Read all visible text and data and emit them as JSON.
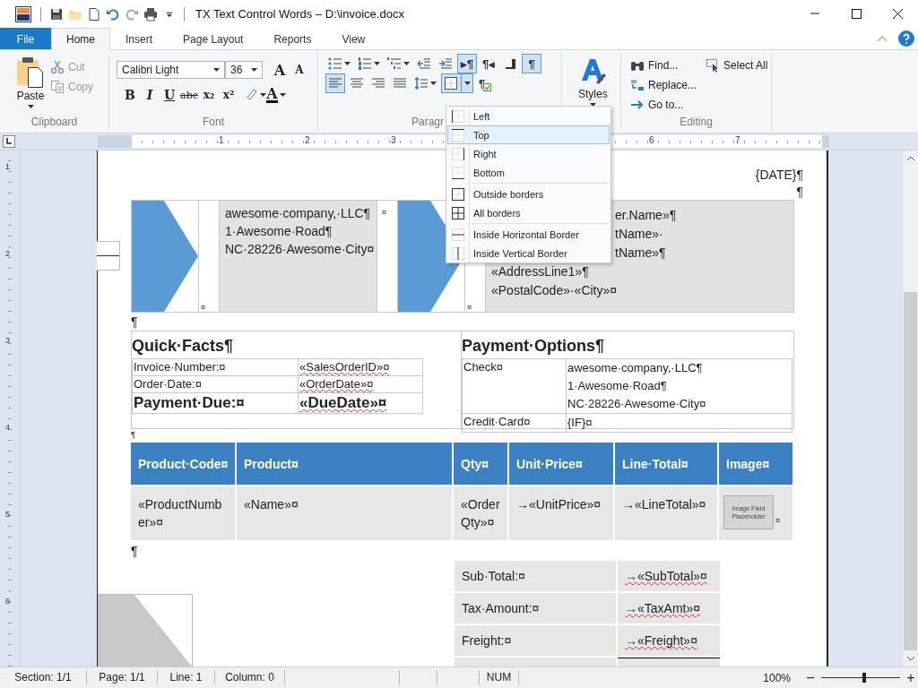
{
  "window": {
    "title": "TX Text Control Words – D:\\invoice.docx"
  },
  "quick_access": [
    {
      "kind": "save"
    },
    {
      "kind": "open"
    },
    {
      "kind": "new"
    },
    {
      "kind": "undo"
    },
    {
      "kind": "redo"
    },
    {
      "kind": "print"
    },
    {
      "kind": "customize"
    }
  ],
  "ribbon_tabs": [
    {
      "label": "File",
      "kind": "backstage",
      "selected": false
    },
    {
      "label": "Home",
      "kind": "tab",
      "selected": true
    },
    {
      "label": "Insert",
      "kind": "tab",
      "selected": false
    },
    {
      "label": "Page Layout",
      "kind": "tab",
      "selected": false
    },
    {
      "label": "Reports",
      "kind": "tab",
      "selected": false
    },
    {
      "label": "View",
      "kind": "tab",
      "selected": false
    }
  ],
  "clipboard": {
    "label": "Clipboard",
    "paste": "Paste",
    "small_buttons": [
      {
        "label": "Cut",
        "kind": "cut",
        "disabled": true
      },
      {
        "label": "Copy",
        "kind": "copy",
        "disabled": true
      }
    ]
  },
  "font": {
    "label": "Font",
    "font_name": "Calibri Light",
    "font_size": "36",
    "size_buttons": [
      {
        "glyph": "A",
        "kind": "grow"
      },
      {
        "glyph": "A",
        "kind": "shrink"
      }
    ],
    "format_buttons": [
      {
        "glyph": "B",
        "kind": "bold",
        "dropdown": false
      },
      {
        "glyph": "I",
        "kind": "italic",
        "dropdown": false
      },
      {
        "glyph": "U",
        "kind": "underline",
        "dropdown": false
      },
      {
        "glyph": "abc",
        "kind": "strike",
        "dropdown": false
      },
      {
        "glyph": "x₂",
        "kind": "sub",
        "dropdown": false
      },
      {
        "glyph": "x²",
        "kind": "sup",
        "dropdown": false
      },
      {
        "kind": "highlight",
        "dropdown": true
      },
      {
        "glyph": "A",
        "kind": "font_color",
        "dropdown": true
      }
    ]
  },
  "paragraph": {
    "label": "Paragr",
    "row1": [
      {
        "kind": "bullets",
        "dropdown": true,
        "pressed": false
      },
      {
        "kind": "numbering",
        "dropdown": true,
        "pressed": false
      },
      {
        "kind": "multilevel",
        "dropdown": true,
        "pressed": false
      },
      {
        "kind": "outdent",
        "dropdown": false,
        "pressed": false
      },
      {
        "kind": "indent",
        "dropdown": false,
        "pressed": false
      },
      {
        "kind": "ltr",
        "glyph": "▸¶",
        "dropdown": false,
        "pressed": true
      },
      {
        "kind": "rtl",
        "glyph": "¶◂",
        "dropdown": false,
        "pressed": false
      },
      {
        "kind": "tab_stop",
        "dropdown": false,
        "pressed": false
      },
      {
        "kind": "marks",
        "glyph": "¶",
        "dropdown": false,
        "pressed": true
      }
    ],
    "row2": [
      {
        "kind": "align_left",
        "dropdown": false,
        "pressed": true
      },
      {
        "kind": "align_center",
        "dropdown": false,
        "pressed": false
      },
      {
        "kind": "align_right",
        "dropdown": false,
        "pressed": false
      },
      {
        "kind": "justify",
        "dropdown": false,
        "pressed": false
      },
      {
        "kind": "line_spacing",
        "dropdown": true,
        "pressed": false
      },
      {
        "kind": "borders",
        "dropdown": true,
        "pressed": true
      },
      {
        "kind": "para_format",
        "glyph": "¶",
        "dropdown": false,
        "pressed": false
      }
    ]
  },
  "styles": {
    "label": "Styles"
  },
  "editing": {
    "label": "Editing",
    "buttons": [
      {
        "label": "Find...",
        "kind": "find"
      },
      {
        "label": "Replace...",
        "kind": "replace"
      },
      {
        "label": "Go to...",
        "kind": "goto"
      },
      {
        "label": "Select All",
        "kind": "select_all"
      }
    ]
  },
  "border_menu": {
    "groups": [
      {
        "items": [
          {
            "label": "Left",
            "kind": "left",
            "selected": false
          },
          {
            "label": "Top",
            "kind": "top",
            "selected": true
          },
          {
            "label": "Right",
            "kind": "right",
            "selected": false
          },
          {
            "label": "Bottom",
            "kind": "bottom",
            "selected": false
          }
        ]
      },
      {
        "items": [
          {
            "label": "Outside borders",
            "kind": "outside",
            "selected": false
          },
          {
            "label": "All borders",
            "kind": "all",
            "selected": false
          }
        ]
      },
      {
        "items": [
          {
            "label": "Inside Horizontal Border",
            "kind": "inside_h",
            "selected": false
          },
          {
            "label": "Inside Vertical Border",
            "kind": "inside_v",
            "selected": false
          }
        ]
      }
    ]
  },
  "horizontal_ruler": {
    "numbers": [
      "1",
      "2",
      "3",
      "6",
      "7"
    ]
  },
  "vertical_ruler": {
    "numbers": [
      "1",
      "2",
      "3",
      "4",
      "5",
      "6"
    ]
  },
  "document": {
    "date": "{DATE}¶",
    "mark_after_date": "¶",
    "header": {
      "company_lines": [
        "awesome·company,·LLC¶",
        "1·Awesome·Road¶",
        "NC·28226·Awesome·City¤"
      ],
      "cell_marks": [
        "¤",
        "¤",
        "¤"
      ],
      "customer_lines": [
        {
          "text": "er.Name»¶",
          "covered": true
        },
        {
          "text": "tName»·",
          "covered": true
        },
        {
          "text": "tName»¶",
          "covered": true
        },
        {
          "text": "«AddressLine1»¶"
        },
        {
          "text": "«PostalCode»·«City»¤"
        }
      ]
    },
    "mark_after_header": "¶",
    "quick_facts": {
      "title": "Quick·Facts¶",
      "rows": [
        {
          "label": "Invoice·Number:¤",
          "value": "«SalesOrderID»¤",
          "emphasis": false
        },
        {
          "label": "Order·Date:¤",
          "value": "«OrderDate»¤",
          "emphasis": false
        },
        {
          "label": "Payment·Due:¤",
          "value": "«DueDate»¤",
          "emphasis": true
        }
      ]
    },
    "payment_options": {
      "title": "Payment·Options¶",
      "rows": [
        {
          "label": "Check¤",
          "lines": [
            "awesome·company,·LLC¶",
            "1·Awesome·Road¶",
            "NC·28226·Awesome·City¤"
          ]
        },
        {
          "label": "Credit·Card¤",
          "lines": [
            "{IF}¤"
          ]
        }
      ]
    },
    "mark_after_facts": "¶",
    "products": {
      "columns": [
        "Product·Code¤",
        "Product¤",
        "Qty¤",
        "Unit·Price¤",
        "Line·Total¤",
        "Image¤"
      ],
      "row": [
        "«ProductNumber»¤",
        "«Name»¤",
        "«OrderQty»¤",
        "→«UnitPrice»¤",
        "→«LineTotal»¤"
      ],
      "image_placeholder": "Image Field Placeholder",
      "image_mark": "¤"
    },
    "mark_after_products": "¶",
    "totals": [
      {
        "label": "Sub·Total:¤",
        "value": "→«SubTotal»¤"
      },
      {
        "label": "Tax·Amount:¤",
        "value": "→«TaxAmt»¤"
      },
      {
        "label": "Freight:¤",
        "value": "→«Freight»¤"
      }
    ]
  },
  "status_bar": {
    "panels": [
      "Section: 1/1",
      "Page: 1/1",
      "Line: 1",
      "Column: 0"
    ],
    "keys": [
      "NUM"
    ],
    "zoom": {
      "reading": "100%",
      "zoom_out": "−",
      "zoom_in": "+",
      "level": 0.55
    }
  }
}
